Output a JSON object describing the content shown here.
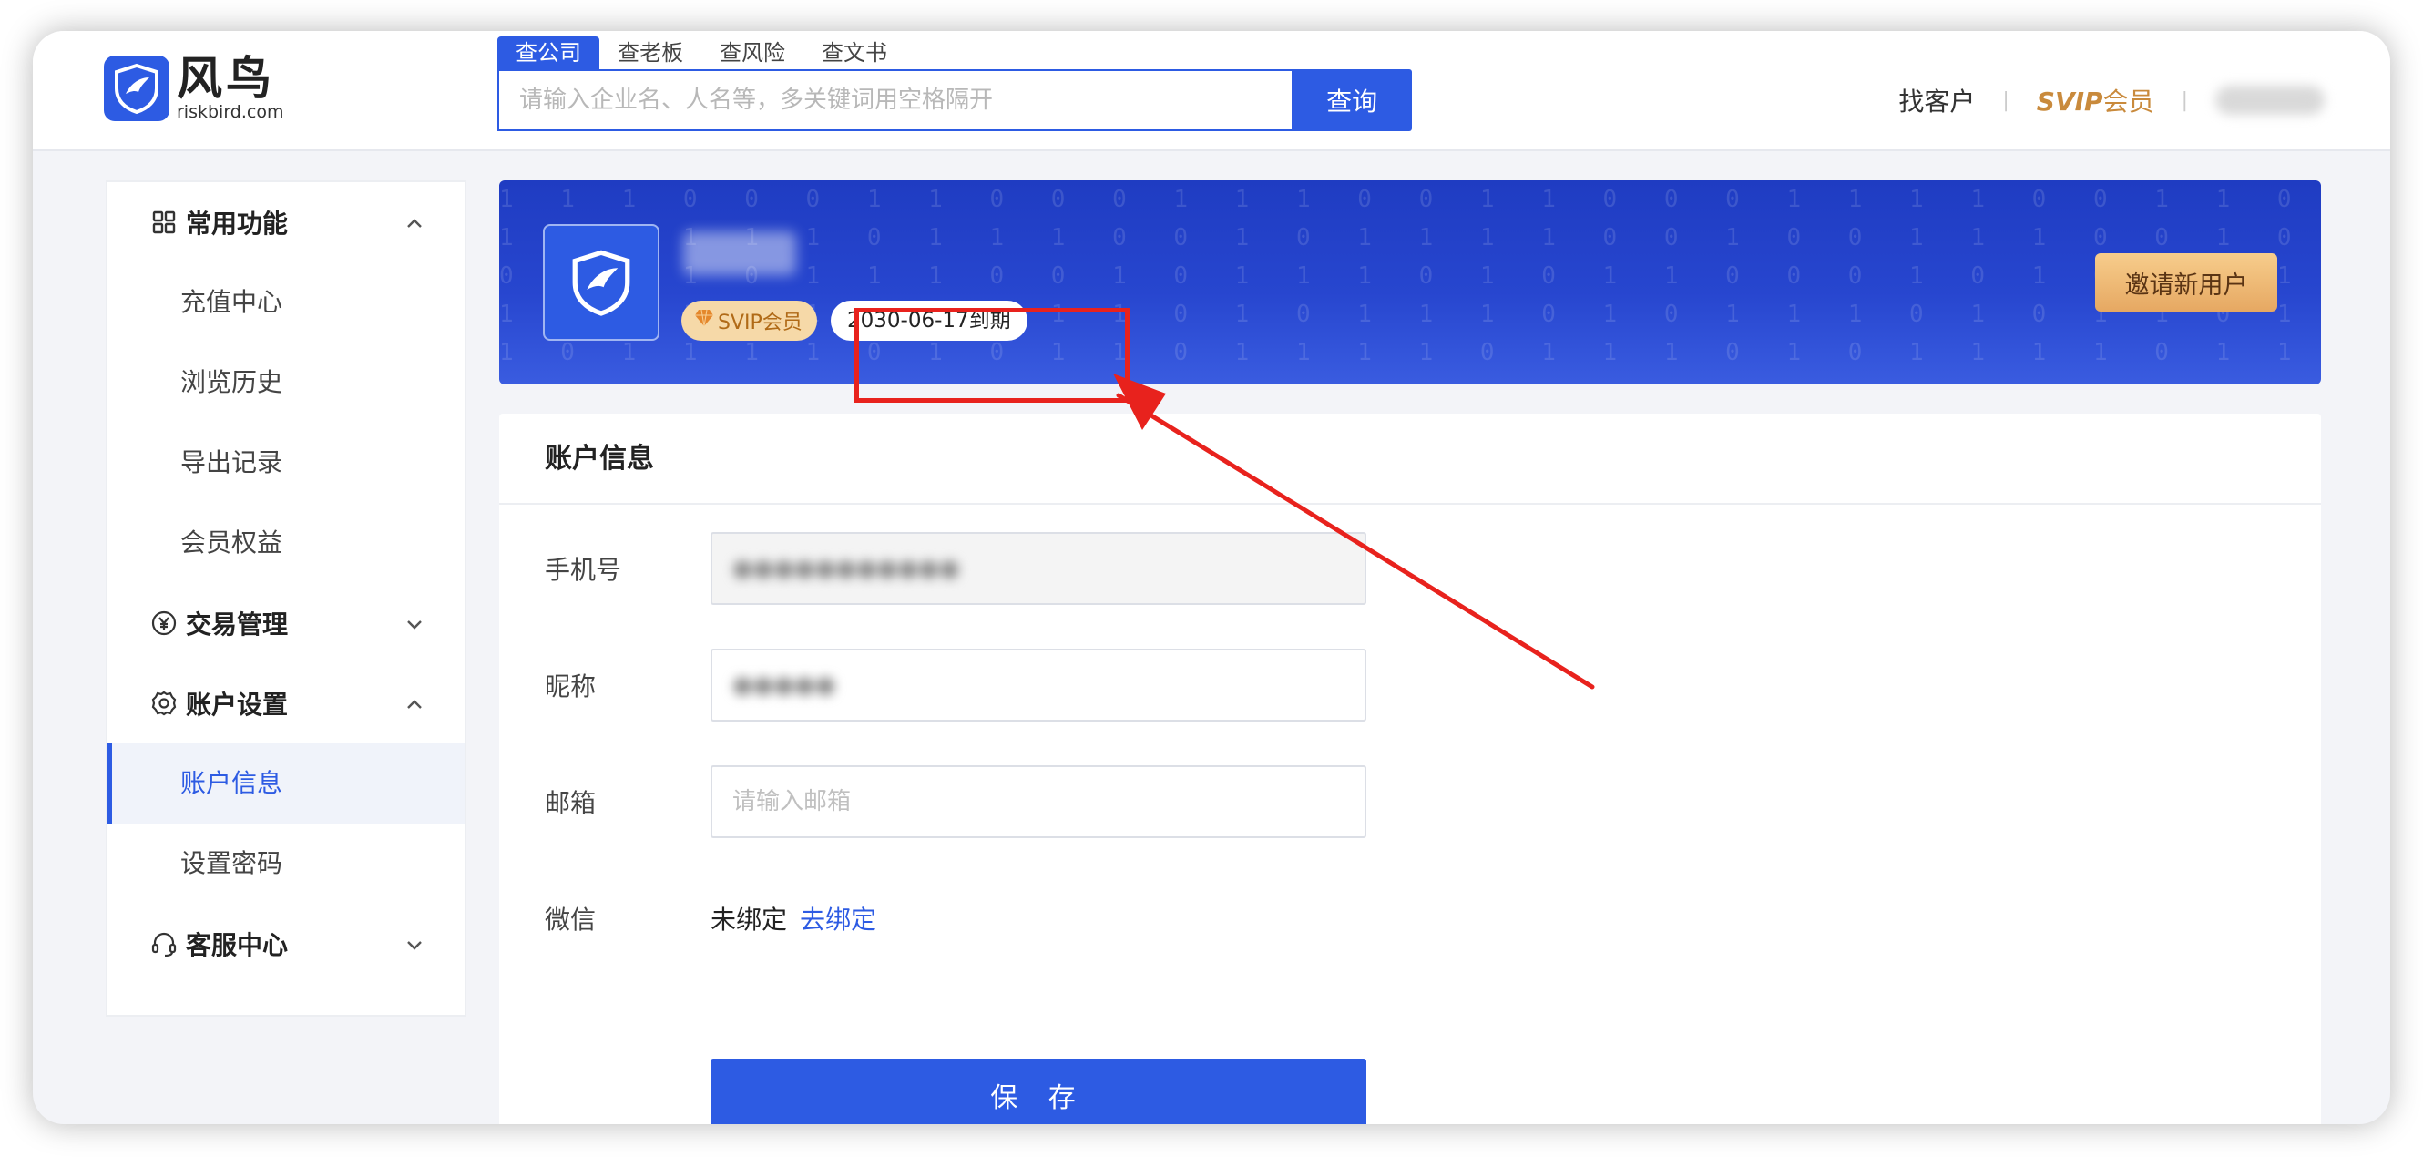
{
  "header": {
    "logo_name": "风鸟",
    "logo_domain": "riskbird.com",
    "search_tabs": [
      {
        "label": "查公司",
        "active": true
      },
      {
        "label": "查老板",
        "active": false
      },
      {
        "label": "查风险",
        "active": false
      },
      {
        "label": "查文书",
        "active": false
      }
    ],
    "search_placeholder": "请输入企业名、人名等，多关键词用空格隔开",
    "search_button": "查询",
    "nav_find_customer": "找客户",
    "nav_svip_prefix": "SVIP",
    "nav_svip_suffix": "会员"
  },
  "sidebar": {
    "groups": [
      {
        "label": "常用功能",
        "icon": "grid-icon",
        "expanded": true,
        "items": [
          "充值中心",
          "浏览历史",
          "导出记录",
          "会员权益"
        ]
      },
      {
        "label": "交易管理",
        "icon": "yuan-icon",
        "expanded": false,
        "items": []
      },
      {
        "label": "账户设置",
        "icon": "gear-icon",
        "expanded": true,
        "items": [
          "账户信息",
          "设置密码"
        ]
      },
      {
        "label": "客服中心",
        "icon": "headset-icon",
        "expanded": false,
        "items": []
      }
    ],
    "active_item": "账户信息"
  },
  "banner": {
    "svip_badge": "SVIP会员",
    "expire_badge": "2030-06-17到期",
    "invite_button": "邀请新用户",
    "binary_rows": [
      "1 1 1 0 0 0 1 1 0 0 0 1 1 1 0 0 1 1 0 0 0 1 1 1 1 0 0 1 1 0 0 0 1 1 0 0 0 1 0 0 0 1 1 1 1 0 0 0 1 1 1 0 0 0 1",
      "1 0 1 1 1 1 0 1 1 1 0 0 1 0 1 1 1 1 0 0 1 0 0 1 1 1 0 0 1 0 1 1 1 0 0 1 0 1 0 1 0 0 0 1 1 1 0 1 0 0 0 1 1 1 0 0",
      "0 0 1 1 0 1 1 1 0 0 1 0 1 1 1 0 1 0 1 1 0 0 0 1 0 1 0 1 0 1 0 0 1 1 0 0 1 0 1 0 0 1 0 1 0 1 1 0 0 1 0 1 1 0",
      "1 0 1 1 0 1 1 0 1 1 1 0 1 0 1 1 1 0 1 0 1 1 1 0 1 0 1 1 0 1 1 1 0 1 0 1 1 1 0 1 0 1 1 0 1 0 1 0 1 0 1 0 1 1",
      "1 0 1 1 1 1 0 1 0 1 1 0 1 1 1 1 0 1 1 1 0 1 0 1 1 1 1 0 1 1 0 1 1 0 1 1 1 1 0 1 0 1 0 1 1 1 0 1 0 1 0 1 1 1"
    ]
  },
  "account": {
    "title": "账户信息",
    "phone_label": "手机号",
    "nickname_label": "昵称",
    "email_label": "邮箱",
    "email_placeholder": "请输入邮箱",
    "wechat_label": "微信",
    "wechat_status": "未绑定",
    "wechat_bind_link": "去绑定",
    "save_button": "保 存"
  },
  "colors": {
    "primary": "#2d5be3",
    "svip_gold": "#c98a3c",
    "annotation_red": "#e8221d"
  }
}
